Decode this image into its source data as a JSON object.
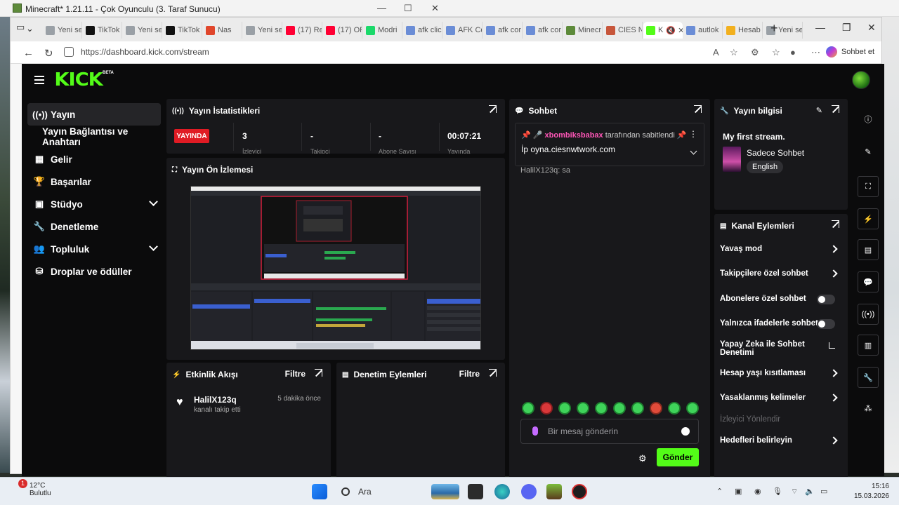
{
  "background_window": {
    "title": "Minecraft* 1.21.11 - Çok Oyunculu (3. Taraf Sunucu)"
  },
  "browser": {
    "tabs": [
      {
        "label": "Yeni se",
        "color": "#9aa0a6"
      },
      {
        "label": "TikTok",
        "color": "#111111"
      },
      {
        "label": "Yeni se",
        "color": "#9aa0a6"
      },
      {
        "label": "TikTok",
        "color": "#111111"
      },
      {
        "label": "Nas",
        "color": "#e0462b"
      },
      {
        "label": "Yeni se",
        "color": "#9aa0a6"
      },
      {
        "label": "(17) Re",
        "color": "#ff0033"
      },
      {
        "label": "(17) OF",
        "color": "#ff0033"
      },
      {
        "label": "Modri",
        "color": "#1bd96a"
      },
      {
        "label": "afk clic",
        "color": "#6b8dd6"
      },
      {
        "label": "AFK Co",
        "color": "#6b8dd6"
      },
      {
        "label": "afk cor",
        "color": "#6b8dd6"
      },
      {
        "label": "afk cor",
        "color": "#6b8dd6"
      },
      {
        "label": "Minecr",
        "color": "#5d8a3a"
      },
      {
        "label": "CIES N",
        "color": "#c7563b"
      },
      {
        "label": "K",
        "color": "#53fc18"
      },
      {
        "label": "autlok",
        "color": "#6b8dd6"
      },
      {
        "label": "Hesab",
        "color": "#f2b01e"
      },
      {
        "label": "Yeni se",
        "color": "#9aa0a6"
      }
    ],
    "url": "https://dashboard.kick.com/stream",
    "copilot_label": "Sohbet et"
  },
  "kick": {
    "logo": "KICK",
    "beta": "BETA",
    "sidebar": [
      {
        "label": "Yayın",
        "icon": "broadcast-icon",
        "glyph": "((•))",
        "active": true
      },
      {
        "label": "Yayın Bağlantısı ve Anahtarı",
        "icon": "",
        "glyph": "",
        "sub": true
      },
      {
        "label": "Gelir",
        "icon": "chart-icon",
        "glyph": "▦"
      },
      {
        "label": "Başarılar",
        "icon": "trophy-icon",
        "glyph": "🏆"
      },
      {
        "label": "Stüdyo",
        "icon": "studio-icon",
        "glyph": "▣",
        "chevron": true
      },
      {
        "label": "Denetleme",
        "icon": "wrench-icon",
        "glyph": "🔧"
      },
      {
        "label": "Topluluk",
        "icon": "community-icon",
        "glyph": "👥",
        "chevron": true
      },
      {
        "label": "Droplar ve ödüller",
        "icon": "drops-icon",
        "glyph": "⛁"
      }
    ],
    "stats": {
      "title": "Yayın İstatistikleri",
      "live_badge": "YAYINDA",
      "values": [
        "3",
        "-",
        "-",
        "00:07:21"
      ],
      "labels": [
        "İzleyici",
        "Takipçi",
        "Abone Sayısı",
        "Yayında"
      ]
    },
    "preview": {
      "title": "Yayın Ön İzlemesi"
    },
    "activity": {
      "title": "Etkinlik Akışı",
      "filter": "Filtre",
      "event_user": "HalilX123q",
      "event_text": "kanalı takip etti",
      "event_time": "5 dakika önce"
    },
    "mod_actions": {
      "title": "Denetim Eylemleri",
      "filter": "Filtre"
    },
    "chat": {
      "title": "Sohbet",
      "pinned_by_user": "xbombiksbabax",
      "pinned_by_text": "tarafından sabitlendi",
      "pinned_message": "İp oyna.ciesnwtwork.com",
      "peek_message": "HalilX123q: sa",
      "input_placeholder": "Bir mesaj gönderin",
      "send_label": "Gönder"
    },
    "stream_info": {
      "title": "Yayın bilgisi",
      "stream_title": "My first stream.",
      "category": "Sadece Sohbet",
      "language": "English"
    },
    "channel_actions": {
      "title": "Kanal Eylemleri",
      "items": [
        {
          "label": "Yavaş mod",
          "control": "arrow"
        },
        {
          "label": "Takipçilere özel sohbet",
          "control": "arrow"
        },
        {
          "label": "Abonelere özel sohbet",
          "control": "toggle"
        },
        {
          "label": "Yalnızca ifadelerle sohbet",
          "control": "toggle"
        },
        {
          "label": "Yapay Zeka ile Sohbet Denetimi",
          "control": "external"
        },
        {
          "label": "Hesap yaşı kısıtlaması",
          "control": "arrow"
        },
        {
          "label": "Yasaklanmış kelimeler",
          "control": "arrow"
        },
        {
          "label": "İzleyici Yönlendir",
          "control": "none",
          "disabled": true
        },
        {
          "label": "Hedefleri belirleyin",
          "control": "arrow"
        }
      ]
    }
  },
  "taskbar": {
    "weather_temp": "12°C",
    "weather_text": "Bulutlu",
    "weather_badge": "1",
    "search_label": "Ara",
    "time": "15:16",
    "date": "15.03.2026"
  }
}
